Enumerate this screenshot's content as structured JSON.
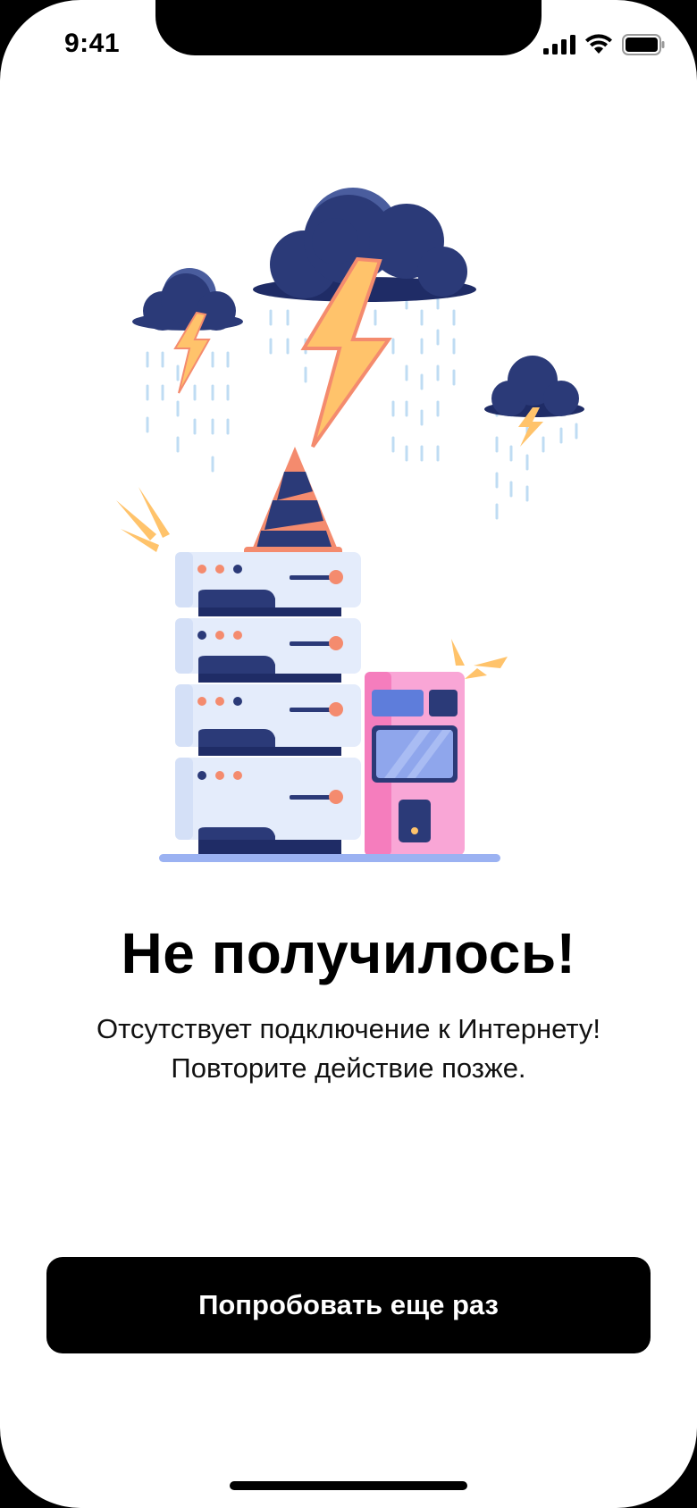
{
  "status_bar": {
    "time": "9:41",
    "icons": [
      "cellular-signal-icon",
      "wifi-icon",
      "battery-icon"
    ]
  },
  "illustration": {
    "subject": "server-rack-storm-outage",
    "icons": [
      "storm-cloud-icon",
      "lightning-bolt-icon",
      "traffic-cone-icon",
      "server-rack-icon",
      "router-box-icon"
    ]
  },
  "error": {
    "title": "Не получилось!",
    "message_line1": "Отсутствует подключение к Интернету!",
    "message_line2": "Повторите действие позже."
  },
  "actions": {
    "retry_label": "Попробовать еще раз"
  },
  "colors": {
    "background": "#FFFFFF",
    "button_bg": "#000000",
    "button_text": "#FFFFFF",
    "cloud": "#2B3A78",
    "bolt": "#FFC36B",
    "accent_coral": "#F48B6E",
    "server_panel": "#E4ECFB",
    "device_pink": "#F78CC4"
  }
}
